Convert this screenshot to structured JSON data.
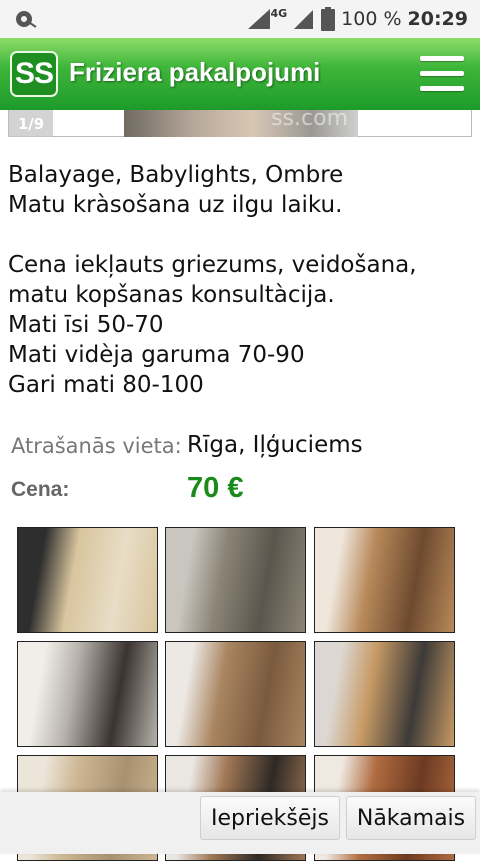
{
  "status_bar": {
    "network": "4G",
    "battery": "100 %",
    "time": "20:29",
    "icons": [
      "notification-icon",
      "signal-icon",
      "battery-icon"
    ]
  },
  "header": {
    "logo": "SS",
    "title": "Friziera pakalpojumi",
    "menu_icon": "hamburger-menu-icon",
    "colors": {
      "gradient_top": "#8fdc6a",
      "gradient_bottom": "#1d9b2a"
    }
  },
  "gallery": {
    "counter": "1/9",
    "watermark": "ss.com"
  },
  "description": {
    "lines": [
      "Balayage, Babylights, Ombre",
      "Matu kràsošana uz ilgu laiku.",
      "",
      "Cena iekļauts griezums, veidošana,",
      "matu kopšanas konsultàcija.",
      "Mati īsi 50-70",
      "Mati vidèja garuma 70-90",
      "Gari mati 80-100"
    ]
  },
  "details": {
    "location_label": "Atrašanās vieta:",
    "location_value": "Rīga, Iļģuciems",
    "price_label": "Cena:",
    "price_value": "70 €",
    "price_color": "#1a8a1a"
  },
  "thumbnails": [
    {
      "name": "thumb-1",
      "colors": [
        "#2e2e2e",
        "#d9c59e",
        "#e8ddc6"
      ]
    },
    {
      "name": "thumb-2",
      "colors": [
        "#c9c6c0",
        "#8c8577",
        "#5a564d"
      ]
    },
    {
      "name": "thumb-3",
      "colors": [
        "#efe7dc",
        "#b8895a",
        "#6d4a2f"
      ]
    },
    {
      "name": "thumb-4",
      "colors": [
        "#f1ede8",
        "#b6b2ab",
        "#3a3330"
      ]
    },
    {
      "name": "thumb-5",
      "colors": [
        "#ece8e3",
        "#a98560",
        "#7a5a3e"
      ]
    },
    {
      "name": "thumb-6",
      "colors": [
        "#dcd7d2",
        "#c79a64",
        "#3d3a38"
      ]
    },
    {
      "name": "thumb-7",
      "colors": [
        "#ece6da",
        "#cdb692",
        "#a89170"
      ]
    },
    {
      "name": "thumb-8",
      "colors": [
        "#eae6e1",
        "#a07755",
        "#2e2925"
      ]
    },
    {
      "name": "thumb-9",
      "colors": [
        "#efe9e2",
        "#b06c40",
        "#6c3a22"
      ]
    }
  ],
  "bottom_nav": {
    "prev_label": "Iepriekšējs",
    "next_label": "Nākamais"
  }
}
